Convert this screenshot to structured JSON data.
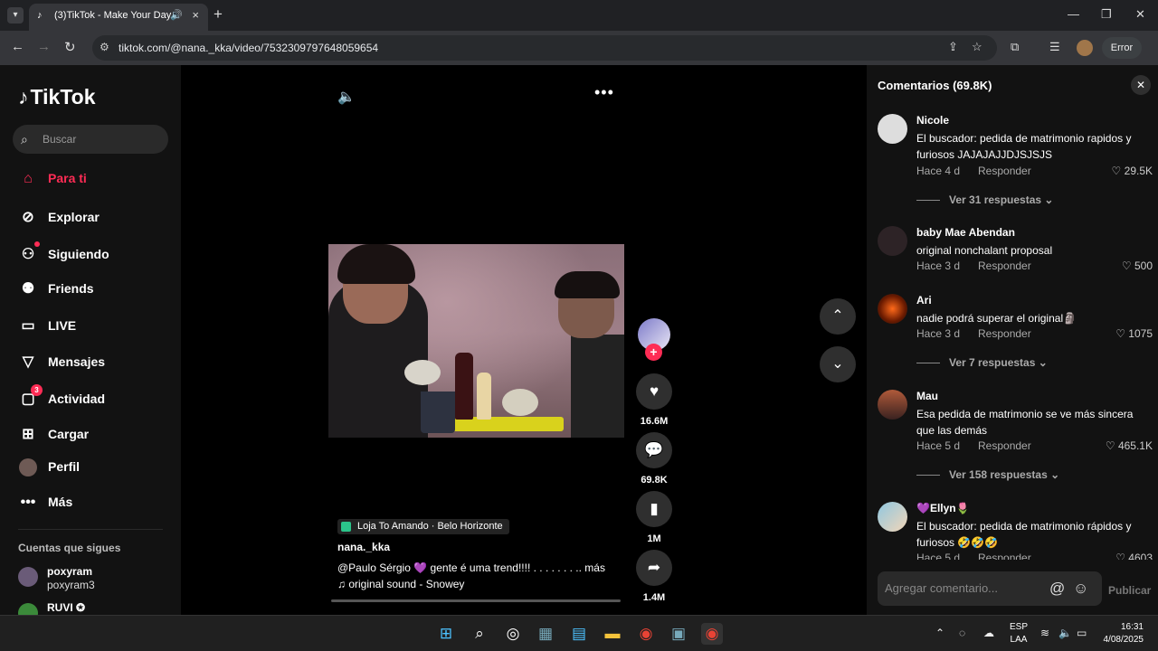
{
  "browser": {
    "tab_title": "(3)TikTok - Make Your Day",
    "url": "tiktok.com/@nana._kka/video/7532309797648059654",
    "profile_button": "Error"
  },
  "sidebar": {
    "logo": "TikTok",
    "search_placeholder": "Buscar",
    "items": [
      {
        "label": "Para ti",
        "icon": "home-icon",
        "active": true
      },
      {
        "label": "Explorar",
        "icon": "compass-icon"
      },
      {
        "label": "Siguiendo",
        "icon": "following-icon"
      },
      {
        "label": "Friends",
        "icon": "friends-icon"
      },
      {
        "label": "LIVE",
        "icon": "live-icon"
      },
      {
        "label": "Mensajes",
        "icon": "send-icon"
      },
      {
        "label": "Actividad",
        "icon": "activity-icon",
        "badge": "3"
      },
      {
        "label": "Cargar",
        "icon": "upload-icon"
      },
      {
        "label": "Perfil",
        "icon": "profile-avatar"
      },
      {
        "label": "Más",
        "icon": "more-icon"
      }
    ],
    "following_title": "Cuentas que sigues",
    "following": [
      {
        "name": "poxyram",
        "handle": "poxyram3"
      },
      {
        "name": "RUVI ✪",
        "handle": ""
      }
    ]
  },
  "video": {
    "location": "Loja To Amando · Belo Horizonte",
    "author": "nana._kka",
    "description_mention": "@Paulo Sérgio",
    "description_heart": "💜",
    "description_text": "gente é uma trend!!!! . . . .  . . . ..   más",
    "sound": "♫  original sound - Snowey",
    "likes": "16.6M",
    "comments": "69.8K",
    "saves": "1M",
    "shares": "1.4M"
  },
  "comments_panel": {
    "title": "Comentarios (69.8K)",
    "input_placeholder": "Agregar comentario...",
    "publish_label": "Publicar",
    "reply_label": "Responder",
    "comments": [
      {
        "user": "Nicole",
        "text": "El buscador: pedida de matrimonio rapidos y furiosos JAJAJAJJDJSJSJS",
        "time": "Hace 4 d",
        "likes": "29.5K",
        "replies": "Ver 31 respuestas ⌄"
      },
      {
        "user": "baby Mae Abendan",
        "text": "original nonchalant proposal",
        "time": "Hace 3 d",
        "likes": "500",
        "replies": ""
      },
      {
        "user": "Ari",
        "text": "nadie podrá superar el original🗿",
        "time": "Hace 3 d",
        "likes": "1075",
        "replies": "Ver 7 respuestas ⌄"
      },
      {
        "user": "Mau",
        "text": "Esa pedida de matrimonio se ve más sincera que las demás",
        "time": "Hace 5 d",
        "likes": "465.1K",
        "replies": "Ver 158 respuestas ⌄"
      },
      {
        "user": "💜Ellyn🌷",
        "text": "El buscador: pedida de matrimonio rápidos y furiosos 🤣🤣🤣",
        "time": "Hace 5 d",
        "likes": "4603",
        "replies": ""
      }
    ]
  },
  "taskbar": {
    "lang_top": "ESP",
    "lang_bottom": "LAA",
    "time": "16:31",
    "date": "4/08/2025"
  }
}
